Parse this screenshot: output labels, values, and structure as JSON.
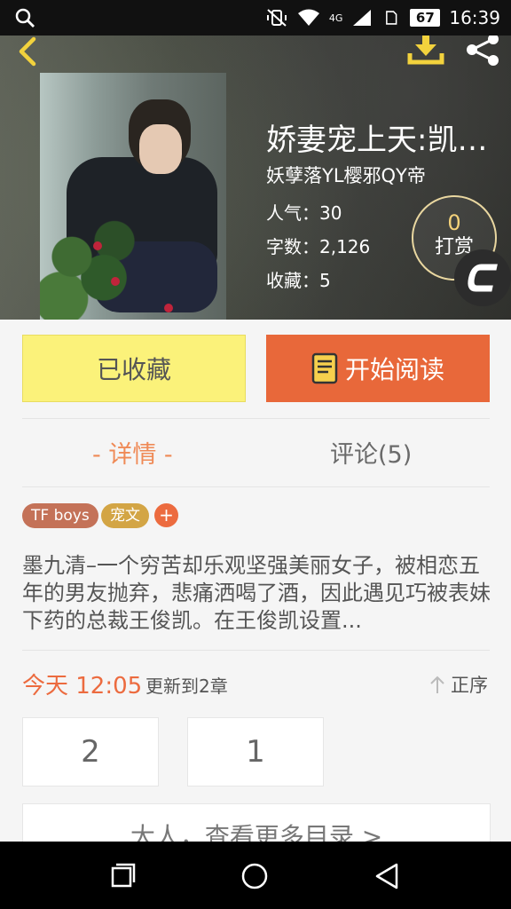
{
  "status_bar": {
    "network": "4G",
    "battery": "67",
    "time": "16:39"
  },
  "book": {
    "title": "娇妻宠上天:凯家...",
    "author": "妖孽落YL樱邪QY帝",
    "stats": {
      "popularity": "人气：30",
      "word_count": "字数：2,126",
      "favorites": "收藏：5"
    },
    "tip": {
      "count": "0",
      "label": "打赏"
    }
  },
  "actions": {
    "favorited_label": "已收藏",
    "start_reading_label": "开始阅读"
  },
  "tabs": [
    {
      "label": "- 详情 -",
      "active": true
    },
    {
      "label": "评论(5)",
      "active": false
    }
  ],
  "tags": [
    {
      "label": "TF boys",
      "color": "#c47258"
    },
    {
      "label": "宠文",
      "color": "#d3a545"
    }
  ],
  "add_tag_symbol": "+",
  "synopsis": "墨九清–一个穷苦却乐观坚强美丽女子，被相恋五年的男友抛弃，悲痛洒喝了酒，因此遇见巧被表妹下药的总裁王俊凯。在王俊凯设置...",
  "update": {
    "time": "今天 12:05",
    "info": "更新到2章",
    "sort_label": "正序"
  },
  "chapters": [
    "2",
    "1"
  ],
  "more_catalog_label": "大人，查看更多目录 >",
  "colors": {
    "accent_orange": "#e8683a",
    "favorite_yellow": "#fbf27a",
    "tab_active": "#ef8a56",
    "tip_gold": "#f4d27a"
  },
  "icons": {
    "search": "search-icon",
    "back": "chevron-left-icon",
    "download": "download-icon",
    "share": "share-icon",
    "book": "book-icon",
    "sort": "arrow-up-icon"
  }
}
